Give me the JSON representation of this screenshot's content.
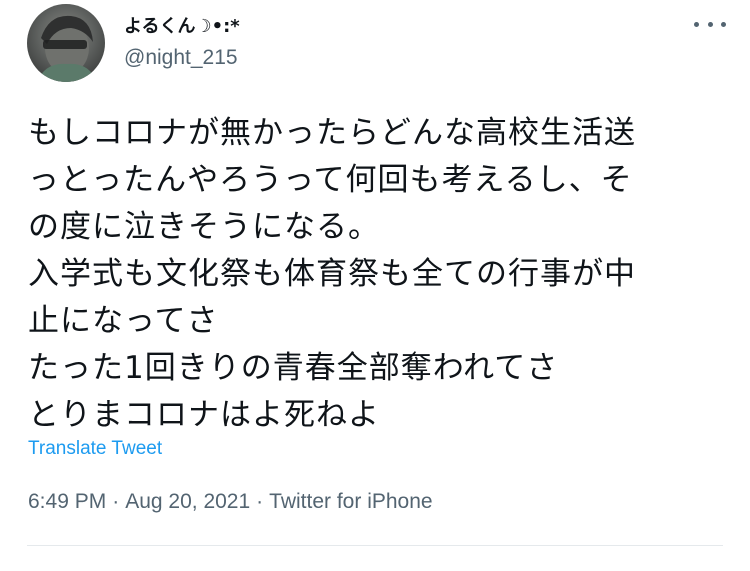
{
  "user": {
    "display_name": "よるくん☽•:*",
    "handle": "@night_215",
    "avatar_icon": "profile-photo"
  },
  "more_icon": "more-horizontal-icon",
  "tweet": {
    "lines": [
      "もしコロナが無かったらどんな高校生活送",
      "っとったんやろうって何回も考えるし、そ",
      "の度に泣きそうになる。",
      "入学式も文化祭も体育祭も全ての行事が中",
      "止になってさ",
      "たった1回きりの青春全部奪われてさ",
      "とりまコロナはよ死ねよ"
    ]
  },
  "translate_label": "Translate Tweet",
  "meta": {
    "time": "6:49 PM",
    "separator": "·",
    "date": "Aug 20, 2021",
    "source": "Twitter for iPhone"
  },
  "colors": {
    "text": "#0f1419",
    "secondary": "#536471",
    "link": "#1d9bf0",
    "divider": "#e5e9ec"
  }
}
